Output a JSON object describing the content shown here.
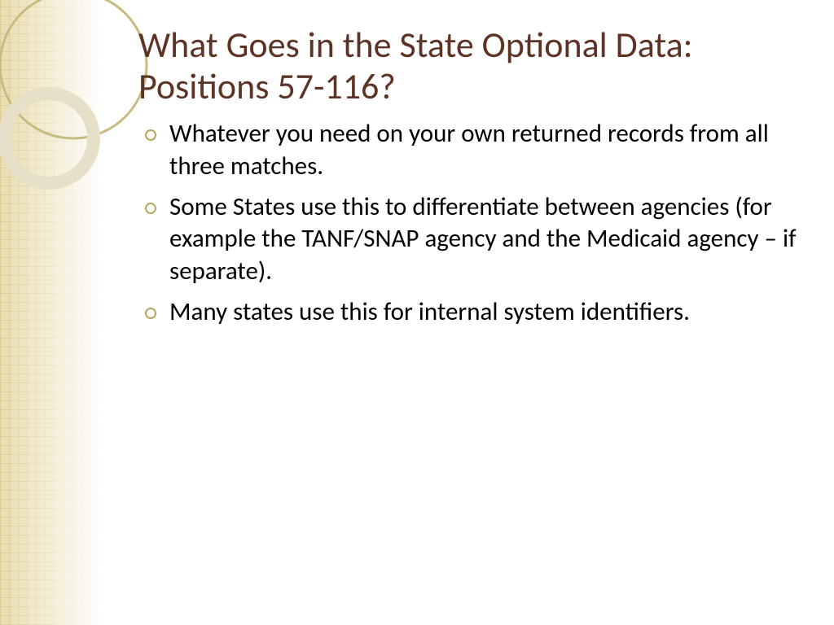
{
  "title": "What Goes in the State Optional Data: Positions 57-116?",
  "bullets": [
    "Whatever you need on your own returned records from all three matches.",
    "Some States use this to differentiate between agencies (for example the TANF/SNAP agency and the Medicaid agency – if separate).",
    "Many states use this for internal system identifiers."
  ]
}
